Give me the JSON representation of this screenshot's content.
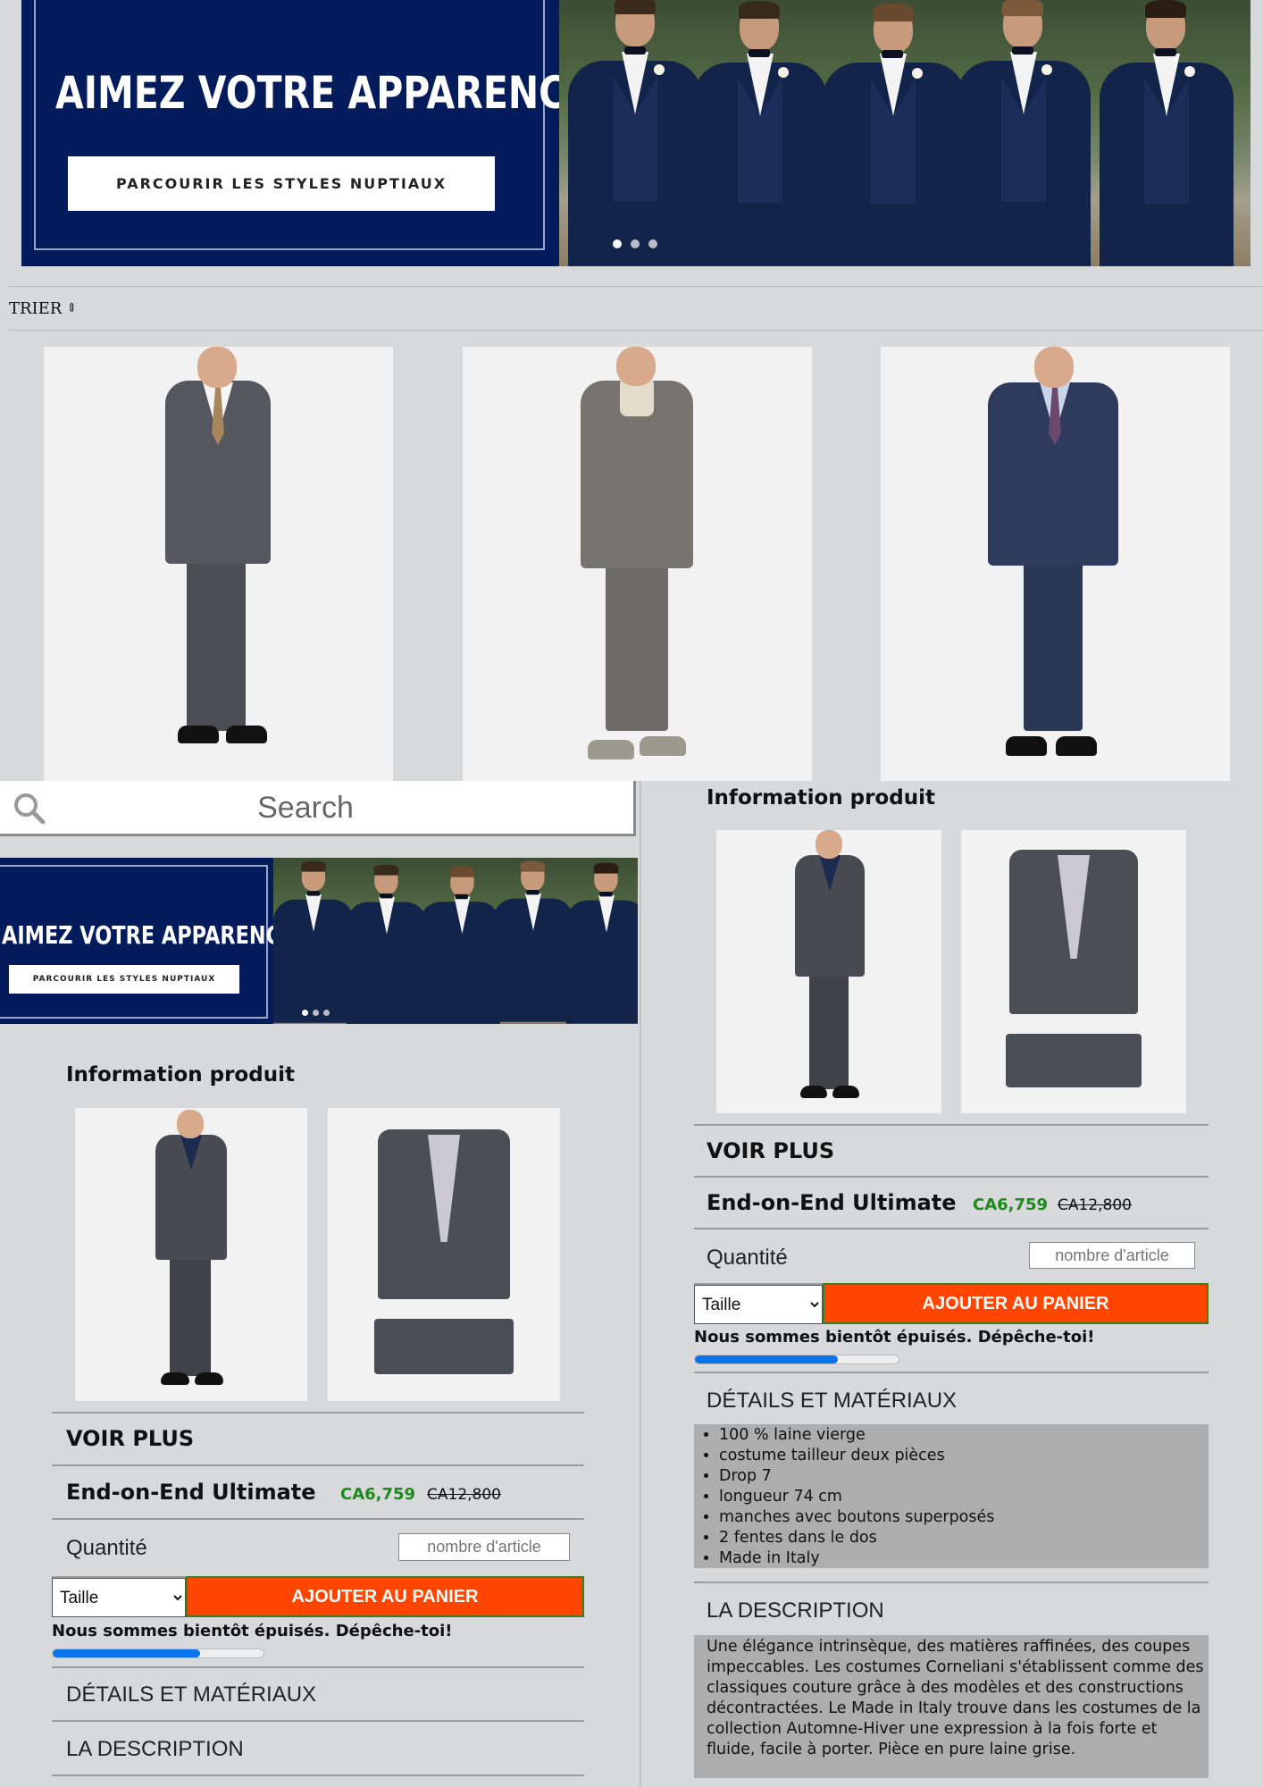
{
  "hero": {
    "headline": "AIMEZ VOTRE APPARENCE",
    "cta": "PARCOURIR LES STYLES NUPTIAUX",
    "slides_total": 3,
    "active_slide": 1
  },
  "sort": {
    "label": "TRIER",
    "icon": "sort-icon"
  },
  "search": {
    "placeholder": "Search",
    "icon": "search-icon"
  },
  "product": {
    "section_title": "Information produit",
    "see_more": "VOIR PLUS",
    "name": "End-on-End Ultimate",
    "price": "CA6,759",
    "original_price": "CA12,800",
    "quantity_label": "Quantité",
    "quantity_placeholder": "nombre d'article",
    "size_select": "Taille",
    "add_to_cart": "AJOUTER AU PANIER",
    "stock_message": "Nous sommes bientôt épuisés. Dépêche-toi!",
    "stock_level": 0.7,
    "details_heading": "DÉTAILS ET MATÉRIAUX",
    "details": [
      "100 % laine vierge",
      "costume tailleur deux pièces",
      "Drop 7",
      "longueur 74 cm",
      "manches avec boutons superposés",
      "2 fentes dans le dos",
      "Made in Italy"
    ],
    "description_heading": "LA DESCRIPTION",
    "description": "Une élégance intrinsèque, des matières raffinées, des coupes impeccables. Les costumes Corneliani s'établissent comme des classiques couture grâce à des modèles et des constructions décontractées. Le Made in Italy trouve dans les costumes de la collection Automne-Hiver une expression à la fois forte et fluide, facile à porter. Pièce en pure laine grise."
  },
  "colors": {
    "hero_navy": "#041b5c",
    "cta_orange": "#ff4500",
    "price_green": "#1e8a1e",
    "stock_bar": "#0a72ea",
    "page_bg": "#d8d9da"
  }
}
